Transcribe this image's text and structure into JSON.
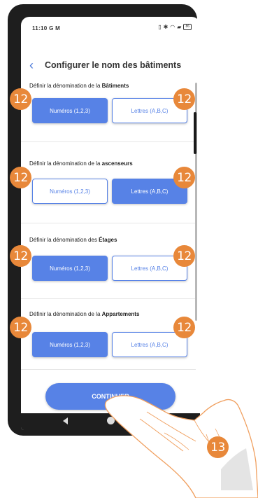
{
  "status_bar": {
    "time": "11:10",
    "left_icons": "G M",
    "battery": "86"
  },
  "header": {
    "back_icon": "chevron-left-icon",
    "title": "Configurer le nom des bâtiments"
  },
  "sections": [
    {
      "label_prefix": "Définir la dénomination de la ",
      "label_bold": "Bâtiments",
      "left_label": "Numéros (1,2,3)",
      "right_label": "Lettres (A,B,C)",
      "selected": "left"
    },
    {
      "label_prefix": "Définir la dénomination de la ",
      "label_bold": "ascenseurs",
      "left_label": "Numéros (1,2,3)",
      "right_label": "Lettres (A,B,C)",
      "selected": "right"
    },
    {
      "label_prefix": "Définir la dénomination des ",
      "label_bold": "Étages",
      "left_label": "Numéros (1,2,3)",
      "right_label": "Lettres (A,B,C)",
      "selected": "left"
    },
    {
      "label_prefix": "Définir la dénomination de la ",
      "label_bold": "Appartements",
      "left_label": "Numéros (1,2,3)",
      "right_label": "Lettres (A,B,C)",
      "selected": "left"
    }
  ],
  "continue_label": "CONTINUER",
  "callouts": {
    "option_marker": "12",
    "tap_marker": "13"
  },
  "colors": {
    "accent": "#5782e6",
    "callout": "#e8883a",
    "phone_frame": "#1e1e1e"
  }
}
